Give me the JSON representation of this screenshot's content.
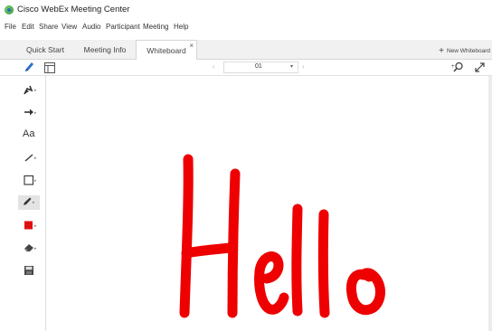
{
  "window": {
    "title": "Cisco WebEx Meeting Center"
  },
  "menu": [
    "File",
    "Edit",
    "Share",
    "View",
    "Audio",
    "Participant",
    "Meeting",
    "Help"
  ],
  "tabs": [
    {
      "label": "Quick Start",
      "active": false
    },
    {
      "label": "Meeting Info",
      "active": false
    },
    {
      "label": "Whiteboard",
      "active": true,
      "close": "×"
    }
  ],
  "new_whiteboard": {
    "label": "New Whiteboard",
    "icon": "plus-icon"
  },
  "pager": {
    "prev": "‹",
    "next": "›",
    "value": "01",
    "caret": "▾"
  },
  "tools": [
    {
      "name": "pointer-tool",
      "icon": "pointer-icon"
    },
    {
      "name": "arrow-tool",
      "icon": "arrow-icon"
    },
    {
      "name": "text-tool",
      "label": "Aa"
    },
    {
      "name": "line-tool",
      "icon": "line-icon"
    },
    {
      "name": "rectangle-tool",
      "icon": "rectangle-icon"
    },
    {
      "name": "pen-tool",
      "icon": "pen-icon"
    },
    {
      "name": "color-tool",
      "icon": "color-swatch-icon",
      "color": "#e01010"
    },
    {
      "name": "eraser-tool",
      "icon": "eraser-icon"
    },
    {
      "name": "save-tool",
      "icon": "save-icon"
    }
  ],
  "drawing": {
    "color": "#ee0000"
  }
}
